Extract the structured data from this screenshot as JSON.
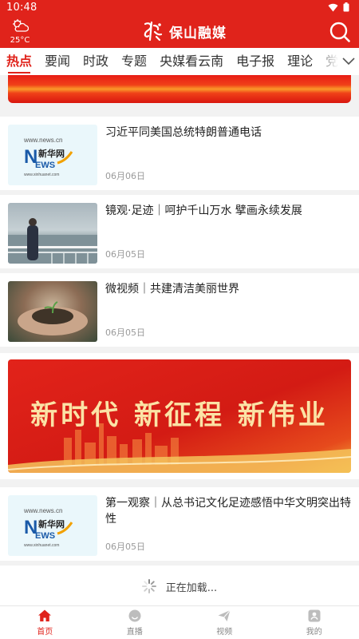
{
  "status_bar": {
    "time": "10:48"
  },
  "header": {
    "weather": {
      "temperature": "25°C",
      "icon": "partly-cloudy-icon"
    },
    "app_name": "保山融媒",
    "search_icon": "search-icon"
  },
  "tabs": [
    {
      "label": "热点",
      "active": true
    },
    {
      "label": "要闻",
      "active": false
    },
    {
      "label": "时政",
      "active": false
    },
    {
      "label": "专题",
      "active": false
    },
    {
      "label": "央媒看云南",
      "active": false
    },
    {
      "label": "电子报",
      "active": false
    },
    {
      "label": "理论",
      "active": false
    },
    {
      "label": "党建",
      "active": false
    }
  ],
  "feed": {
    "items": [
      {
        "title": "习近平同美国总统特朗普通电话",
        "date": "06月06日",
        "thumb": "xinhua"
      },
      {
        "title": "镜观·足迹｜呵护千山万水  擘画永续发展",
        "date": "06月05日",
        "thumb": "sea"
      },
      {
        "title": "微视频｜共建清洁美丽世界",
        "date": "06月05日",
        "thumb": "soil"
      },
      {
        "title": "第一观察｜从总书记文化足迹感悟中华文明突出特性",
        "date": "06月05日",
        "thumb": "xinhua"
      }
    ],
    "banner_text": "新时代  新征程  新伟业",
    "xinhua_logo": {
      "site": "www.news.cn",
      "cn": "新华网",
      "en_n": "N",
      "en_ews": "EWS",
      "url": "www.xinhuanet.com"
    },
    "loading_text": "正在加载..."
  },
  "bottom_nav": [
    {
      "label": "首页",
      "icon": "home-icon",
      "active": true
    },
    {
      "label": "直播",
      "icon": "live-icon",
      "active": false
    },
    {
      "label": "视频",
      "icon": "video-send-icon",
      "active": false
    },
    {
      "label": "我的",
      "icon": "profile-icon",
      "active": false
    }
  ],
  "colors": {
    "brand_red": "#e0231b",
    "banner_gold": "#fbe3a6"
  }
}
